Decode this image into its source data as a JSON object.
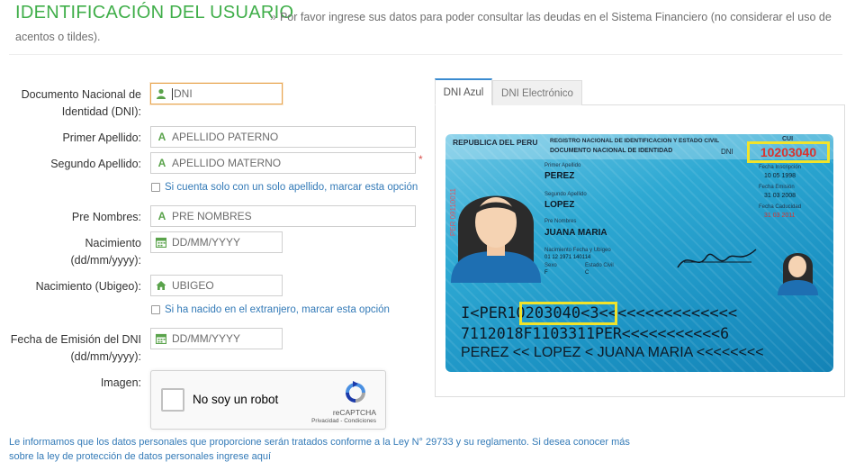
{
  "header": {
    "title": "IDENTIFICACIÓN DEL USUARIO",
    "subtitle": "Por favor ingrese sus datos para poder consultar las deudas en el Sistema Financiero (no considerar el uso de acentos o tildes).",
    "raquo": "»"
  },
  "form": {
    "dni_label": "Documento Nacional de Identidad (DNI):",
    "dni_placeholder": "DNI",
    "apellido1_label": "Primer Apellido:",
    "apellido1_placeholder": "APELLIDO PATERNO",
    "apellido2_label": "Segundo Apellido:",
    "apellido2_placeholder": "APELLIDO MATERNO",
    "required_mark": "*",
    "one_surname_check": "Si cuenta solo con un solo apellido, marcar esta opción",
    "nombres_label": "Pre Nombres:",
    "nombres_placeholder": "PRE NOMBRES",
    "nacimiento_label": "Nacimiento (dd/mm/yyyy):",
    "nacimiento_placeholder": "DD/MM/YYYY",
    "ubigeo_label": "Nacimiento (Ubigeo):",
    "ubigeo_placeholder": "UBIGEO",
    "abroad_check": "Si ha nacido en el extranjero, marcar esta opción",
    "emision_label": "Fecha de Emisión del DNI (dd/mm/yyyy):",
    "emision_placeholder": "DD/MM/YYYY",
    "imagen_label": "Imagen:"
  },
  "captcha": {
    "label": "No soy un robot",
    "brand": "reCAPTCHA",
    "terms": "Privacidad - Condiciones"
  },
  "footer": {
    "text": "Le informamos que los datos personales que proporcione serán tratados conforme a la Ley N° 29733 y su reglamento. Si desea conocer más sobre la ley de protección de datos personales ingrese aquí"
  },
  "tabs": [
    {
      "label": "DNI Azul",
      "active": true
    },
    {
      "label": "DNI Electrónico",
      "active": false
    }
  ],
  "dni_card": {
    "country": "REPUBLICA DEL PERU",
    "registry": "REGISTRO NACIONAL DE IDENTIFICACION Y ESTADO CIVIL",
    "doc_title": "DOCUMENTO NACIONAL DE IDENTIDAD",
    "dni_tag": "DNI",
    "cui": "CUI",
    "number": "10203040",
    "primer_apellido_lbl": "Primer Apellido",
    "primer_apellido": "PEREZ",
    "segundo_apellido_lbl": "Segundo Apellido",
    "segundo_apellido": "LOPEZ",
    "nombres_lbl": "Pre Nombres",
    "nombres": "JUANA MARIA",
    "nac_lbl": "Nacimiento  Fecha y Ubigeo",
    "nac_val": "01 12 1971    140114",
    "sexo_lbl": "Sexo",
    "sexo_val": "F",
    "ec_lbl": "Estado Civil",
    "ec_val": "C",
    "inscripcion_lbl": "Fecha Inscripción",
    "inscripcion_val": "10 05 1998",
    "emision_lbl": "Fecha Emisión",
    "emision_val": "31 03 2008",
    "caducidad_lbl": "Fecha Caducidad",
    "caducidad_val": "31 03 2011",
    "side_text": "PER 09110011",
    "mrz1_prefix": "I<PER",
    "mrz1_number": "10203040",
    "mrz1_suffix": "<3<<<<<<<<<<<<<<<",
    "mrz2": "7112018F1103311PER<<<<<<<<<<<6",
    "mrz3": "PEREZ << LOPEZ < JUANA MARIA <<<<<<<<"
  },
  "colors": {
    "title_green": "#3fae49",
    "link_blue": "#337ab7",
    "highlight_yellow": "#f2e32a",
    "number_red": "#d9332f",
    "tab_active_border": "#3a8bd0"
  }
}
